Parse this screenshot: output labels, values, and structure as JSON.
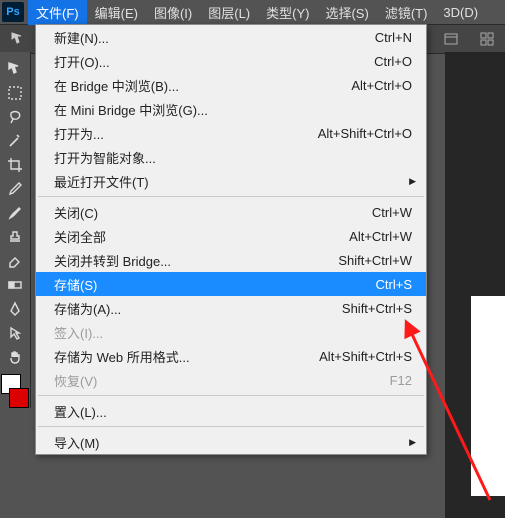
{
  "logo": "Ps",
  "menubar": {
    "items": [
      {
        "label": "文件(F)",
        "open": true
      },
      {
        "label": "编辑(E)"
      },
      {
        "label": "图像(I)"
      },
      {
        "label": "图层(L)"
      },
      {
        "label": "类型(Y)"
      },
      {
        "label": "选择(S)"
      },
      {
        "label": "滤镜(T)"
      },
      {
        "label": "3D(D)"
      }
    ]
  },
  "dropdown": {
    "sections": [
      [
        {
          "label": "新建(N)...",
          "shortcut": "Ctrl+N"
        },
        {
          "label": "打开(O)...",
          "shortcut": "Ctrl+O"
        },
        {
          "label": "在 Bridge 中浏览(B)...",
          "shortcut": "Alt+Ctrl+O"
        },
        {
          "label": "在 Mini Bridge 中浏览(G)..."
        },
        {
          "label": "打开为...",
          "shortcut": "Alt+Shift+Ctrl+O"
        },
        {
          "label": "打开为智能对象..."
        },
        {
          "label": "最近打开文件(T)",
          "submenu": true
        }
      ],
      [
        {
          "label": "关闭(C)",
          "shortcut": "Ctrl+W"
        },
        {
          "label": "关闭全部",
          "shortcut": "Alt+Ctrl+W"
        },
        {
          "label": "关闭并转到 Bridge...",
          "shortcut": "Shift+Ctrl+W"
        },
        {
          "label": "存储(S)",
          "shortcut": "Ctrl+S",
          "selected": true
        },
        {
          "label": "存储为(A)...",
          "shortcut": "Shift+Ctrl+S"
        },
        {
          "label": "签入(I)...",
          "disabled": true
        },
        {
          "label": "存储为 Web 所用格式...",
          "shortcut": "Alt+Shift+Ctrl+S"
        },
        {
          "label": "恢复(V)",
          "shortcut": "F12",
          "disabled": true
        }
      ],
      [
        {
          "label": "置入(L)..."
        }
      ],
      [
        {
          "label": "导入(M)",
          "submenu": true
        }
      ]
    ]
  },
  "annotation_color": "#ff1a1a"
}
